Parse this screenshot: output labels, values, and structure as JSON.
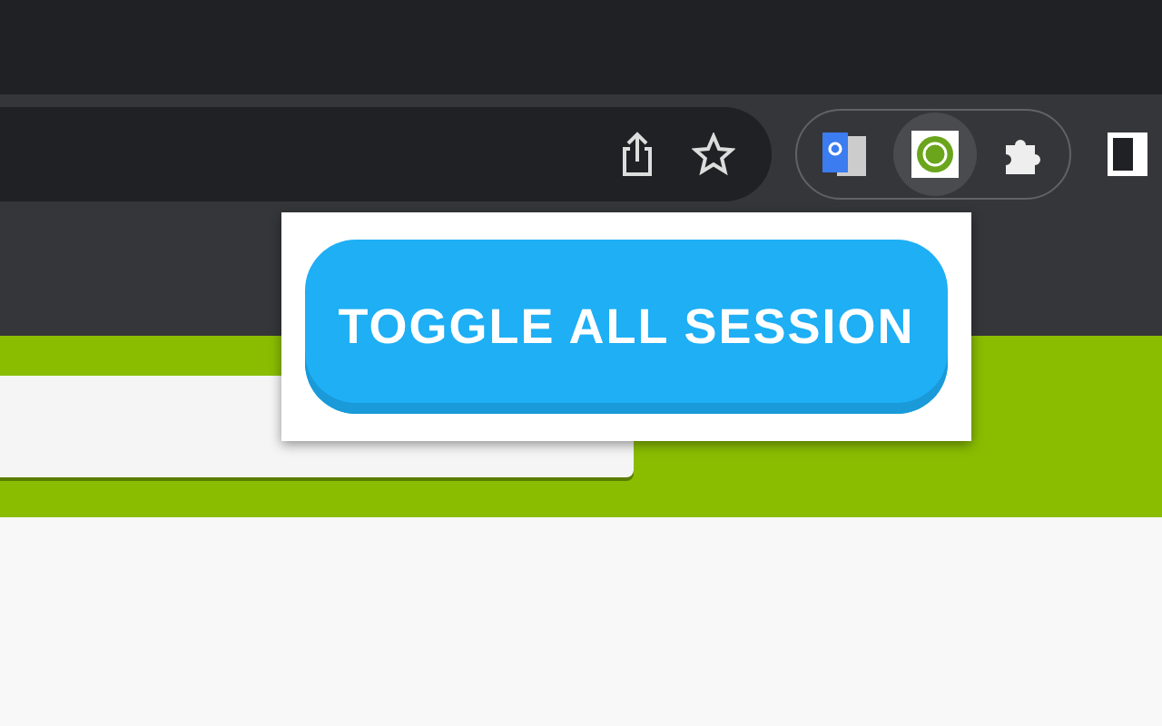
{
  "popup": {
    "button": "TOGGLE ALL SESSION"
  }
}
